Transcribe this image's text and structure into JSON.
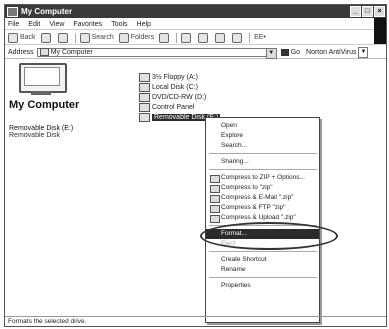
{
  "window": {
    "title": "My Computer"
  },
  "menubar": [
    "File",
    "Edit",
    "View",
    "Favorites",
    "Tools",
    "Help"
  ],
  "toolbar": {
    "back": "Back",
    "search": "Search",
    "folders": "Folders",
    "views": "EE•"
  },
  "address": {
    "label": "Address",
    "value": "My Computer",
    "go": "Go",
    "norton": "Norton AntiVirus"
  },
  "left_pane": {
    "title": "My Computer",
    "selected_name": "Removable Disk (E:)",
    "selected_type": "Removable Disk"
  },
  "drives": [
    {
      "label": "3½ Floppy (A:)",
      "icon": "floppy-icon"
    },
    {
      "label": "Local Disk (C:)",
      "icon": "hard-disk-icon"
    },
    {
      "label": "DVD/CD-RW (D:)",
      "icon": "cd-drive-icon"
    },
    {
      "label": "Control Panel",
      "icon": "control-panel-icon"
    },
    {
      "label": "Removable Disk (E:)",
      "icon": "removable-disk-icon",
      "selected": true
    }
  ],
  "context_menu": {
    "items": [
      "Open",
      "Explore",
      "Search...",
      "Sharing...",
      "Compress to ZIP + Options...",
      "Compress to \"zip\"",
      "Compress & E-Mail \".zip\"",
      "Compress & FTP \"zip\"",
      "Compress & Upload \".zip\"",
      "Format...",
      "Eject",
      "Create Shortcut",
      "Rename",
      "Properties"
    ],
    "highlighted": "Format..."
  },
  "status": {
    "text": "Formats the selected drive."
  }
}
